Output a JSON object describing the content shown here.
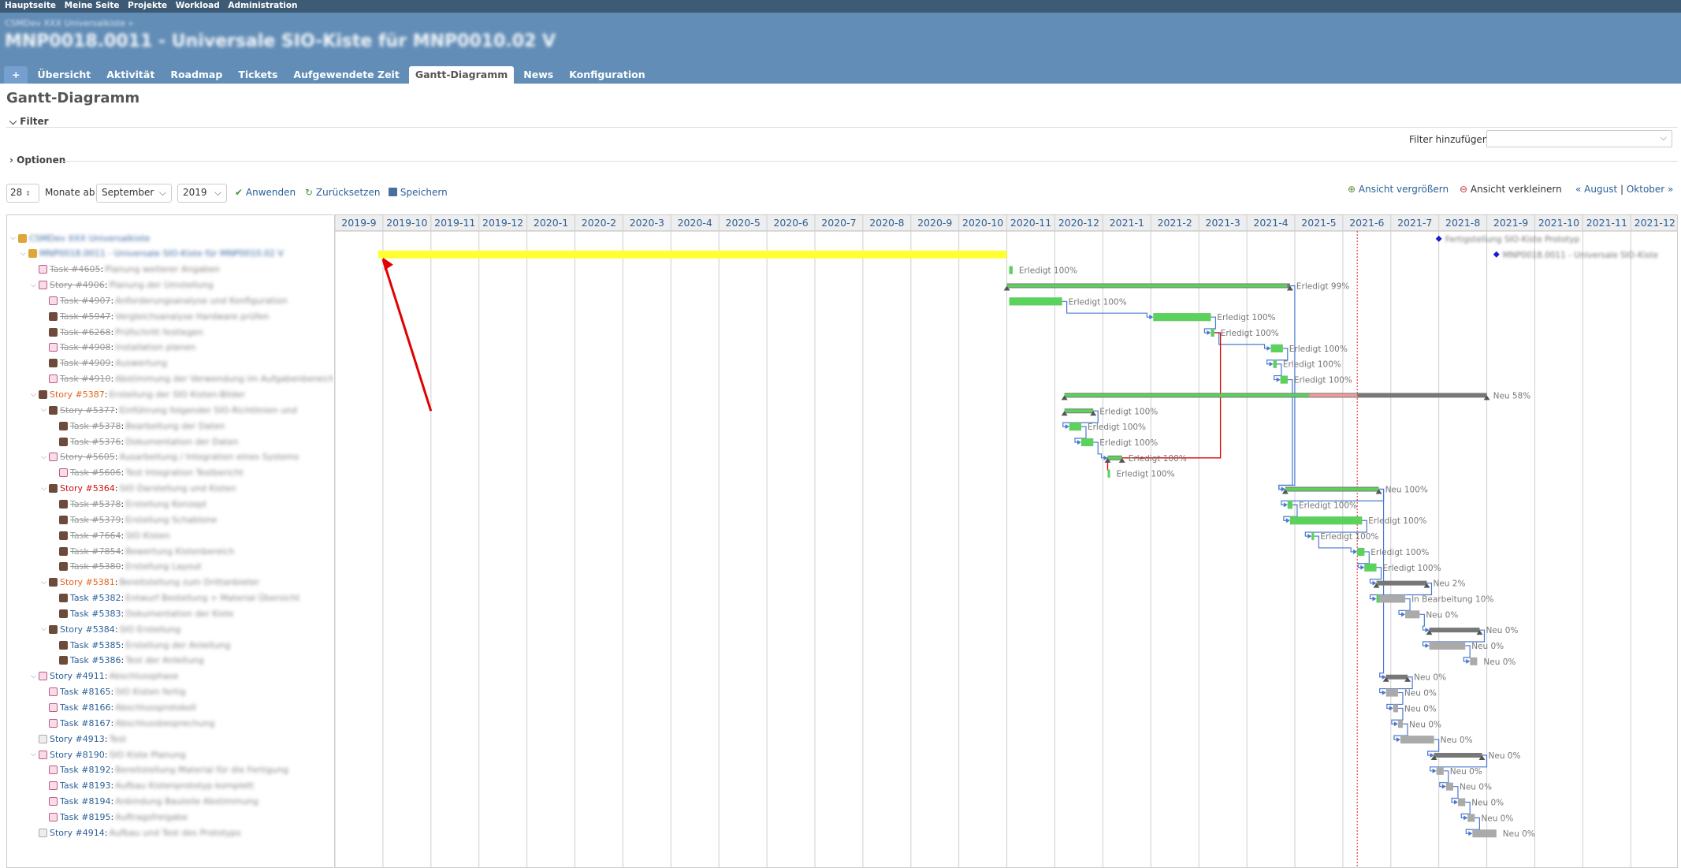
{
  "top_menu": [
    "Hauptseite",
    "Meine Seite",
    "Projekte",
    "Workload",
    "Administration"
  ],
  "header": {
    "parent_project": "CSMDev XXX Universalkiste »",
    "title": "MNP0018.0011 - Universale SIO-Kiste für MNP0010.02 V"
  },
  "tabs": [
    {
      "label": "+",
      "key": "new"
    },
    {
      "label": "Übersicht",
      "key": "overview"
    },
    {
      "label": "Aktivität",
      "key": "activity"
    },
    {
      "label": "Roadmap",
      "key": "roadmap"
    },
    {
      "label": "Tickets",
      "key": "issues"
    },
    {
      "label": "Aufgewendete Zeit",
      "key": "time"
    },
    {
      "label": "Gantt-Diagramm",
      "key": "gantt",
      "active": true
    },
    {
      "label": "News",
      "key": "news"
    },
    {
      "label": "Konfiguration",
      "key": "settings"
    }
  ],
  "page": {
    "title": "Gantt-Diagramm",
    "filter_legend": "Filter",
    "options_legend": "Optionen",
    "filter_add_label": "Filter hinzufügen"
  },
  "controls": {
    "months": "28",
    "months_from_label": "Monate ab",
    "month_select": "September",
    "year_select": "2019",
    "apply": "Anwenden",
    "reset": "Zurücksetzen",
    "save": "Speichern",
    "zoom_in": "Ansicht vergrößern",
    "zoom_out": "Ansicht verkleinern",
    "prev": "« August",
    "separator": "|",
    "next": "Oktober »"
  },
  "timeline": {
    "months": [
      "2019-9",
      "2019-10",
      "2019-11",
      "2019-12",
      "2020-1",
      "2020-2",
      "2020-3",
      "2020-4",
      "2020-5",
      "2020-6",
      "2020-7",
      "2020-8",
      "2020-9",
      "2020-10",
      "2020-11",
      "2020-12",
      "2021-1",
      "2021-2",
      "2021-3",
      "2021-4",
      "2021-5",
      "2021-6",
      "2021-7",
      "2021-8",
      "2021-9",
      "2021-10",
      "2021-11",
      "2021-12"
    ],
    "today_month_fraction": 21.3
  },
  "rows": [
    {
      "indent": 0,
      "avatar": "proj",
      "id": "",
      "blurred": "CSMDev XXX Universalkiste",
      "status": "project"
    },
    {
      "indent": 1,
      "avatar": "proj",
      "id": "",
      "blurred": "MNP0018.0011 - Universale SIO-Kiste für MNP0010.02 V",
      "status": "project"
    },
    {
      "indent": 2,
      "avatar": "task",
      "id": "Task #4605",
      "blurred": "Planung weiterer Angaben",
      "status": "closed"
    },
    {
      "indent": 2,
      "avatar": "task",
      "id": "Story #4906",
      "blurred": "Planung der Umstellung",
      "status": "closed"
    },
    {
      "indent": 3,
      "avatar": "task",
      "id": "Task #4907",
      "blurred": "Anforderungsanalyse und Konfiguration",
      "status": "closed"
    },
    {
      "indent": 3,
      "avatar": "person",
      "id": "Task #5947",
      "blurred": "Vergleichsanalyse Hardware prüfen",
      "status": "closed"
    },
    {
      "indent": 3,
      "avatar": "person",
      "id": "Task #6268",
      "blurred": "Prüfschritt festlegen",
      "status": "closed"
    },
    {
      "indent": 3,
      "avatar": "task",
      "id": "Task #4908",
      "blurred": "Installation planen",
      "status": "closed"
    },
    {
      "indent": 3,
      "avatar": "person",
      "id": "Task #4909",
      "blurred": "Auswertung",
      "status": "closed"
    },
    {
      "indent": 3,
      "avatar": "task",
      "id": "Task #4910",
      "blurred": "Abstimmung der Verwendung im Aufgabenbereich",
      "status": "closed"
    },
    {
      "indent": 2,
      "avatar": "person",
      "id": "Story #5387",
      "blurred": "Erstellung der SIO Kisten-Bilder",
      "status": "orange"
    },
    {
      "indent": 3,
      "avatar": "person",
      "id": "Story #5377",
      "blurred": "Einführung folgender SIO-Richtlinien und",
      "status": "closed"
    },
    {
      "indent": 4,
      "avatar": "person",
      "id": "Task #5378",
      "blurred": "Bearbeitung der Daten",
      "status": "closed"
    },
    {
      "indent": 4,
      "avatar": "person",
      "id": "Task #5376",
      "blurred": "Dokumentation der Daten",
      "status": "closed"
    },
    {
      "indent": 3,
      "avatar": "task",
      "id": "Story #5605",
      "blurred": "Ausarbeitung / Integration eines Systems",
      "status": "closed"
    },
    {
      "indent": 4,
      "avatar": "task",
      "id": "Task #5606",
      "blurred": "Test Integration Testbericht",
      "status": "closed"
    },
    {
      "indent": 3,
      "avatar": "person",
      "id": "Story #5364",
      "blurred": "SIO Darstellung und Kisten",
      "status": "red"
    },
    {
      "indent": 4,
      "avatar": "person",
      "id": "Task #5378",
      "blurred": "Erstellung Konzept",
      "status": "closed"
    },
    {
      "indent": 4,
      "avatar": "person",
      "id": "Task #5379",
      "blurred": "Erstellung Schablone",
      "status": "closed"
    },
    {
      "indent": 4,
      "avatar": "person",
      "id": "Task #7664",
      "blurred": "SIO Kisten",
      "status": "closed"
    },
    {
      "indent": 4,
      "avatar": "person",
      "id": "Task #7854",
      "blurred": "Bewertung Kistenbereich",
      "status": "closed"
    },
    {
      "indent": 4,
      "avatar": "person",
      "id": "Task #5380",
      "blurred": "Erstellung Layout",
      "status": "closed"
    },
    {
      "indent": 3,
      "avatar": "person",
      "id": "Story #5381",
      "blurred": "Bereitstellung zum Drittanbieter",
      "status": "orange"
    },
    {
      "indent": 4,
      "avatar": "person",
      "id": "Task #5382",
      "blurred": "Entwurf Bestellung + Material Übersicht",
      "status": "open"
    },
    {
      "indent": 4,
      "avatar": "person",
      "id": "Task #5383",
      "blurred": "Dokumentation der Kiste",
      "status": "open"
    },
    {
      "indent": 3,
      "avatar": "person",
      "id": "Story #5384",
      "blurred": "SIO Erstellung",
      "status": "open"
    },
    {
      "indent": 4,
      "avatar": "person",
      "id": "Task #5385",
      "blurred": "Erstellung der Anleitung",
      "status": "open"
    },
    {
      "indent": 4,
      "avatar": "person",
      "id": "Task #5386",
      "blurred": "Test der Anleitung",
      "status": "open"
    },
    {
      "indent": 2,
      "avatar": "task",
      "id": "Story #4911",
      "blurred": "Abschlussphase",
      "status": "open"
    },
    {
      "indent": 3,
      "avatar": "task",
      "id": "Task #8165",
      "blurred": "SIO Kisten fertig",
      "status": "open"
    },
    {
      "indent": 3,
      "avatar": "task",
      "id": "Task #8166",
      "blurred": "Abschlussprotokoll",
      "status": "open"
    },
    {
      "indent": 3,
      "avatar": "task",
      "id": "Task #8167",
      "blurred": "Abschlussbesprechung",
      "status": "open"
    },
    {
      "indent": 2,
      "avatar": "empty",
      "id": "Story #4913",
      "blurred": "Test",
      "status": "open"
    },
    {
      "indent": 2,
      "avatar": "task",
      "id": "Story #8190",
      "blurred": "SIO Kiste Planung",
      "status": "open"
    },
    {
      "indent": 3,
      "avatar": "task",
      "id": "Task #8192",
      "blurred": "Bereitstellung Material für die Fertigung",
      "status": "open"
    },
    {
      "indent": 3,
      "avatar": "task",
      "id": "Task #8193",
      "blurred": "Aufbau Kistenprototyp komplett",
      "status": "open"
    },
    {
      "indent": 3,
      "avatar": "task",
      "id": "Task #8194",
      "blurred": "Anbindung Bauteile Abstimmung",
      "status": "open"
    },
    {
      "indent": 3,
      "avatar": "task",
      "id": "Task #8195",
      "blurred": "Auftragsfreigabe",
      "status": "open"
    },
    {
      "indent": 2,
      "avatar": "empty",
      "id": "Story #4914",
      "blurred": "Aufbau und Test des Prototyps",
      "status": "open"
    }
  ],
  "bars": [
    {
      "row": 0,
      "type": "milestone",
      "start": 23.0,
      "label": "Fertigstellung SIO-Kiste Prototyp"
    },
    {
      "row": 1,
      "type": "milestone",
      "start": 24.2,
      "label": "MNP0018.0011 - Universale SIO-Kiste"
    },
    {
      "row": 2,
      "type": "task",
      "start": 14.05,
      "end": 14.12,
      "done": 1.0,
      "label": "Erledigt 100%"
    },
    {
      "row": 3,
      "type": "parent",
      "start": 14.0,
      "end": 19.9,
      "done": 0.99,
      "label": "Erledigt 99%"
    },
    {
      "row": 4,
      "type": "task",
      "start": 14.05,
      "end": 15.15,
      "done": 1.0,
      "label": "Erledigt 100%"
    },
    {
      "row": 5,
      "type": "task",
      "start": 17.05,
      "end": 18.25,
      "done": 1.0,
      "label": "Erledigt 100%"
    },
    {
      "row": 6,
      "type": "task",
      "start": 18.25,
      "end": 18.32,
      "done": 1.0,
      "label": "Erledigt 100%"
    },
    {
      "row": 7,
      "type": "task",
      "start": 19.5,
      "end": 19.75,
      "done": 1.0,
      "label": "Erledigt 100%"
    },
    {
      "row": 8,
      "type": "task",
      "start": 19.55,
      "end": 19.62,
      "done": 1.0,
      "label": "Erledigt 100%"
    },
    {
      "row": 9,
      "type": "task",
      "start": 19.7,
      "end": 19.85,
      "done": 1.0,
      "label": "Erledigt 100%"
    },
    {
      "row": 10,
      "type": "parent",
      "start": 15.2,
      "end": 24.0,
      "done": 0.58,
      "late_until": 21.3,
      "label": "Neu 58%"
    },
    {
      "row": 11,
      "type": "parent",
      "start": 15.2,
      "end": 15.8,
      "done": 1.0,
      "label": "Erledigt 100%"
    },
    {
      "row": 12,
      "type": "task",
      "start": 15.3,
      "end": 15.55,
      "done": 1.0,
      "label": "Erledigt 100%"
    },
    {
      "row": 13,
      "type": "task",
      "start": 15.55,
      "end": 15.8,
      "done": 1.0,
      "label": "Erledigt 100%"
    },
    {
      "row": 14,
      "type": "parent",
      "start": 16.1,
      "end": 16.4,
      "done": 1.0,
      "label": "Erledigt 100%"
    },
    {
      "row": 15,
      "type": "task",
      "start": 16.1,
      "end": 16.15,
      "done": 1.0,
      "label": "Erledigt 100%"
    },
    {
      "row": 16,
      "type": "parent",
      "start": 19.8,
      "end": 21.75,
      "done": 1.0,
      "label": "Neu 100%"
    },
    {
      "row": 17,
      "type": "task",
      "start": 19.85,
      "end": 19.95,
      "done": 1.0,
      "label": "Erledigt 100%"
    },
    {
      "row": 18,
      "type": "task",
      "start": 19.9,
      "end": 21.4,
      "done": 1.0,
      "label": "Erledigt 100%"
    },
    {
      "row": 19,
      "type": "task",
      "start": 20.35,
      "end": 20.4,
      "done": 1.0,
      "label": "Erledigt 100%"
    },
    {
      "row": 20,
      "type": "task",
      "start": 21.3,
      "end": 21.45,
      "done": 1.0,
      "label": "Erledigt 100%"
    },
    {
      "row": 21,
      "type": "task",
      "start": 21.45,
      "end": 21.7,
      "done": 1.0,
      "label": "Erledigt 100%"
    },
    {
      "row": 22,
      "type": "parent",
      "start": 21.7,
      "end": 22.75,
      "done": 0.02,
      "label": "Neu 2%"
    },
    {
      "row": 23,
      "type": "task",
      "start": 21.7,
      "end": 22.3,
      "done": 0.1,
      "label": "In Bearbeitung 10%"
    },
    {
      "row": 24,
      "type": "task",
      "start": 22.3,
      "end": 22.6,
      "done": 0.0,
      "label": "Neu 0%"
    },
    {
      "row": 25,
      "type": "parent",
      "start": 22.8,
      "end": 23.85,
      "done": 0.0,
      "label": "Neu 0%"
    },
    {
      "row": 26,
      "type": "task",
      "start": 22.8,
      "end": 23.55,
      "done": 0.0,
      "label": "Neu 0%"
    },
    {
      "row": 27,
      "type": "task",
      "start": 23.65,
      "end": 23.8,
      "done": 0.0,
      "label": "Neu 0%"
    },
    {
      "row": 28,
      "type": "parent",
      "start": 21.9,
      "end": 22.35,
      "done": 0.0,
      "label": "Neu 0%"
    },
    {
      "row": 29,
      "type": "task",
      "start": 21.9,
      "end": 22.15,
      "done": 0.0,
      "label": "Neu 0%"
    },
    {
      "row": 30,
      "type": "task",
      "start": 22.05,
      "end": 22.15,
      "done": 0.0,
      "label": "Neu 0%"
    },
    {
      "row": 31,
      "type": "task",
      "start": 22.15,
      "end": 22.25,
      "done": 0.0,
      "label": "Neu 0%"
    },
    {
      "row": 32,
      "type": "task",
      "start": 22.2,
      "end": 22.9,
      "done": 0.0,
      "label": "Neu 0%"
    },
    {
      "row": 33,
      "type": "parent",
      "start": 22.9,
      "end": 23.9,
      "done": 0.0,
      "label": "Neu 0%"
    },
    {
      "row": 34,
      "type": "task",
      "start": 22.95,
      "end": 23.1,
      "done": 0.0,
      "label": "Neu 0%"
    },
    {
      "row": 35,
      "type": "task",
      "start": 23.15,
      "end": 23.3,
      "done": 0.0,
      "label": "Neu 0%"
    },
    {
      "row": 36,
      "type": "task",
      "start": 23.4,
      "end": 23.55,
      "done": 0.0,
      "label": "Neu 0%"
    },
    {
      "row": 37,
      "type": "task",
      "start": 23.6,
      "end": 23.75,
      "done": 0.0,
      "label": "Neu 0%"
    },
    {
      "row": 38,
      "type": "task",
      "start": 23.7,
      "end": 24.2,
      "done": 0.0,
      "label": "Neu 0%"
    }
  ],
  "highlight": {
    "row": 1,
    "start": 0.9,
    "end": 14.0,
    "color": "#ffff33"
  },
  "colors": {
    "done": "#5bd25b",
    "todo": "#aaaaaa",
    "late": "#f29a9a",
    "parent": "#777777",
    "link": "#4a78d0",
    "link_red": "#e00000",
    "today": "#e02020",
    "milestone": "#1a1ad0",
    "arrow": "#e00000"
  }
}
